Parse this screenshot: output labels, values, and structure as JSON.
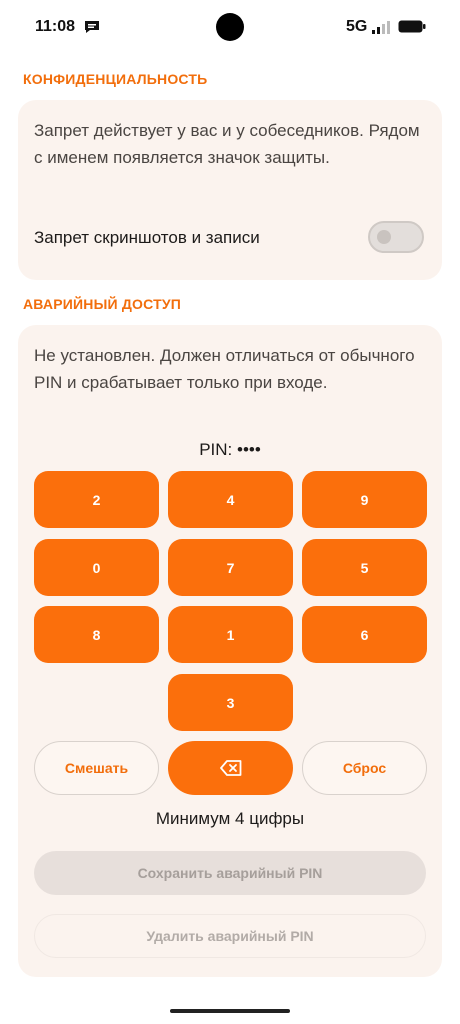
{
  "status_bar": {
    "time": "11:08",
    "network": "5G",
    "icons": [
      "message-icon",
      "signal-icon",
      "battery-icon"
    ]
  },
  "privacy": {
    "title": "КОНФИДЕНЦИАЛЬНОСТЬ",
    "description": "Запрет действует у вас и у собеседников. Рядом с именем появляется значок защиты.",
    "toggle_label": "Запрет скриншотов и записи",
    "toggle_on": false
  },
  "emergency": {
    "title": "АВАРИЙНЫЙ ДОСТУП",
    "description": "Не установлен. Должен отличаться от обычного PIN и срабатывает только при входе.",
    "pin_display": "PIN: ••••",
    "keys": [
      "2",
      "4",
      "9",
      "0",
      "7",
      "5",
      "8",
      "1",
      "6",
      "3"
    ],
    "shuffle_label": "Смешать",
    "backspace_icon": "backspace-icon",
    "reset_label": "Сброс",
    "hint": "Минимум 4 цифры",
    "save_label": "Сохранить аварийный PIN",
    "delete_label": "Удалить аварийный PIN"
  },
  "colors": {
    "accent": "#fb6f0c",
    "section_title": "#f26e0c",
    "card_bg": "#fbf3ee",
    "disabled_btn": "#e7dfdb"
  }
}
